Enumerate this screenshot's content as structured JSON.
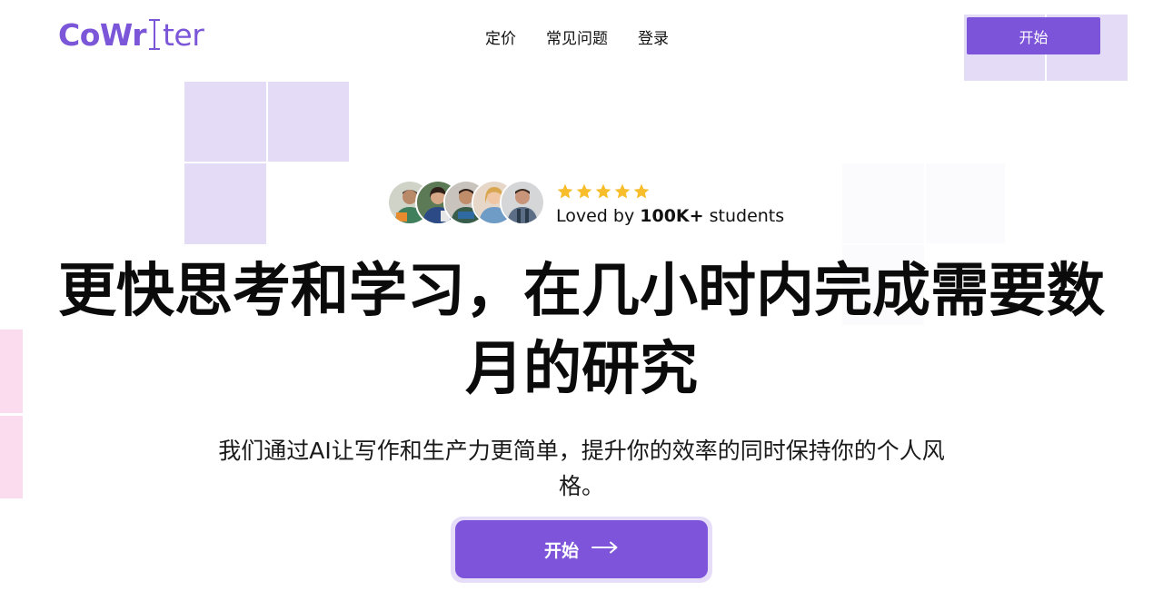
{
  "brand": {
    "logo_prefix": "CoWr",
    "logo_suffix": "ter",
    "color": "#7b56d8"
  },
  "nav": {
    "items": [
      {
        "label": "定价"
      },
      {
        "label": "常见问题"
      },
      {
        "label": "登录"
      }
    ]
  },
  "header": {
    "cta_label": "开始"
  },
  "social_proof": {
    "rating_stars": 5,
    "loved_prefix": "Loved by ",
    "loved_count": "100K+",
    "loved_suffix": " students",
    "star_color": "#f7bd2b"
  },
  "hero": {
    "title": "更快思考和学习，在几小时内完成需要数月的研究",
    "subtitle": "我们通过AI让写作和生产力更简单，提升你的效率的同时保持你的个人风格。",
    "cta_label": "开始",
    "cta_icon": "arrow-right-icon"
  },
  "colors": {
    "accent": "#7c54d9",
    "tile_lavender": "#e4dcf7",
    "tile_pink": "#fbdcef"
  }
}
